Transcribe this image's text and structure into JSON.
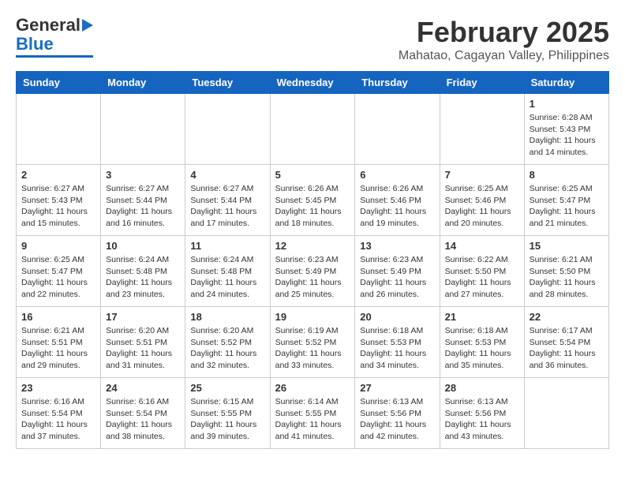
{
  "logo": {
    "general": "General",
    "blue": "Blue"
  },
  "title": "February 2025",
  "subtitle": "Mahatao, Cagayan Valley, Philippines",
  "weekdays": [
    "Sunday",
    "Monday",
    "Tuesday",
    "Wednesday",
    "Thursday",
    "Friday",
    "Saturday"
  ],
  "weeks": [
    [
      {
        "day": "",
        "info": ""
      },
      {
        "day": "",
        "info": ""
      },
      {
        "day": "",
        "info": ""
      },
      {
        "day": "",
        "info": ""
      },
      {
        "day": "",
        "info": ""
      },
      {
        "day": "",
        "info": ""
      },
      {
        "day": "1",
        "info": "Sunrise: 6:28 AM\nSunset: 5:43 PM\nDaylight: 11 hours\nand 14 minutes."
      }
    ],
    [
      {
        "day": "2",
        "info": "Sunrise: 6:27 AM\nSunset: 5:43 PM\nDaylight: 11 hours\nand 15 minutes."
      },
      {
        "day": "3",
        "info": "Sunrise: 6:27 AM\nSunset: 5:44 PM\nDaylight: 11 hours\nand 16 minutes."
      },
      {
        "day": "4",
        "info": "Sunrise: 6:27 AM\nSunset: 5:44 PM\nDaylight: 11 hours\nand 17 minutes."
      },
      {
        "day": "5",
        "info": "Sunrise: 6:26 AM\nSunset: 5:45 PM\nDaylight: 11 hours\nand 18 minutes."
      },
      {
        "day": "6",
        "info": "Sunrise: 6:26 AM\nSunset: 5:46 PM\nDaylight: 11 hours\nand 19 minutes."
      },
      {
        "day": "7",
        "info": "Sunrise: 6:25 AM\nSunset: 5:46 PM\nDaylight: 11 hours\nand 20 minutes."
      },
      {
        "day": "8",
        "info": "Sunrise: 6:25 AM\nSunset: 5:47 PM\nDaylight: 11 hours\nand 21 minutes."
      }
    ],
    [
      {
        "day": "9",
        "info": "Sunrise: 6:25 AM\nSunset: 5:47 PM\nDaylight: 11 hours\nand 22 minutes."
      },
      {
        "day": "10",
        "info": "Sunrise: 6:24 AM\nSunset: 5:48 PM\nDaylight: 11 hours\nand 23 minutes."
      },
      {
        "day": "11",
        "info": "Sunrise: 6:24 AM\nSunset: 5:48 PM\nDaylight: 11 hours\nand 24 minutes."
      },
      {
        "day": "12",
        "info": "Sunrise: 6:23 AM\nSunset: 5:49 PM\nDaylight: 11 hours\nand 25 minutes."
      },
      {
        "day": "13",
        "info": "Sunrise: 6:23 AM\nSunset: 5:49 PM\nDaylight: 11 hours\nand 26 minutes."
      },
      {
        "day": "14",
        "info": "Sunrise: 6:22 AM\nSunset: 5:50 PM\nDaylight: 11 hours\nand 27 minutes."
      },
      {
        "day": "15",
        "info": "Sunrise: 6:21 AM\nSunset: 5:50 PM\nDaylight: 11 hours\nand 28 minutes."
      }
    ],
    [
      {
        "day": "16",
        "info": "Sunrise: 6:21 AM\nSunset: 5:51 PM\nDaylight: 11 hours\nand 29 minutes."
      },
      {
        "day": "17",
        "info": "Sunrise: 6:20 AM\nSunset: 5:51 PM\nDaylight: 11 hours\nand 31 minutes."
      },
      {
        "day": "18",
        "info": "Sunrise: 6:20 AM\nSunset: 5:52 PM\nDaylight: 11 hours\nand 32 minutes."
      },
      {
        "day": "19",
        "info": "Sunrise: 6:19 AM\nSunset: 5:52 PM\nDaylight: 11 hours\nand 33 minutes."
      },
      {
        "day": "20",
        "info": "Sunrise: 6:18 AM\nSunset: 5:53 PM\nDaylight: 11 hours\nand 34 minutes."
      },
      {
        "day": "21",
        "info": "Sunrise: 6:18 AM\nSunset: 5:53 PM\nDaylight: 11 hours\nand 35 minutes."
      },
      {
        "day": "22",
        "info": "Sunrise: 6:17 AM\nSunset: 5:54 PM\nDaylight: 11 hours\nand 36 minutes."
      }
    ],
    [
      {
        "day": "23",
        "info": "Sunrise: 6:16 AM\nSunset: 5:54 PM\nDaylight: 11 hours\nand 37 minutes."
      },
      {
        "day": "24",
        "info": "Sunrise: 6:16 AM\nSunset: 5:54 PM\nDaylight: 11 hours\nand 38 minutes."
      },
      {
        "day": "25",
        "info": "Sunrise: 6:15 AM\nSunset: 5:55 PM\nDaylight: 11 hours\nand 39 minutes."
      },
      {
        "day": "26",
        "info": "Sunrise: 6:14 AM\nSunset: 5:55 PM\nDaylight: 11 hours\nand 41 minutes."
      },
      {
        "day": "27",
        "info": "Sunrise: 6:13 AM\nSunset: 5:56 PM\nDaylight: 11 hours\nand 42 minutes."
      },
      {
        "day": "28",
        "info": "Sunrise: 6:13 AM\nSunset: 5:56 PM\nDaylight: 11 hours\nand 43 minutes."
      },
      {
        "day": "",
        "info": ""
      }
    ]
  ]
}
